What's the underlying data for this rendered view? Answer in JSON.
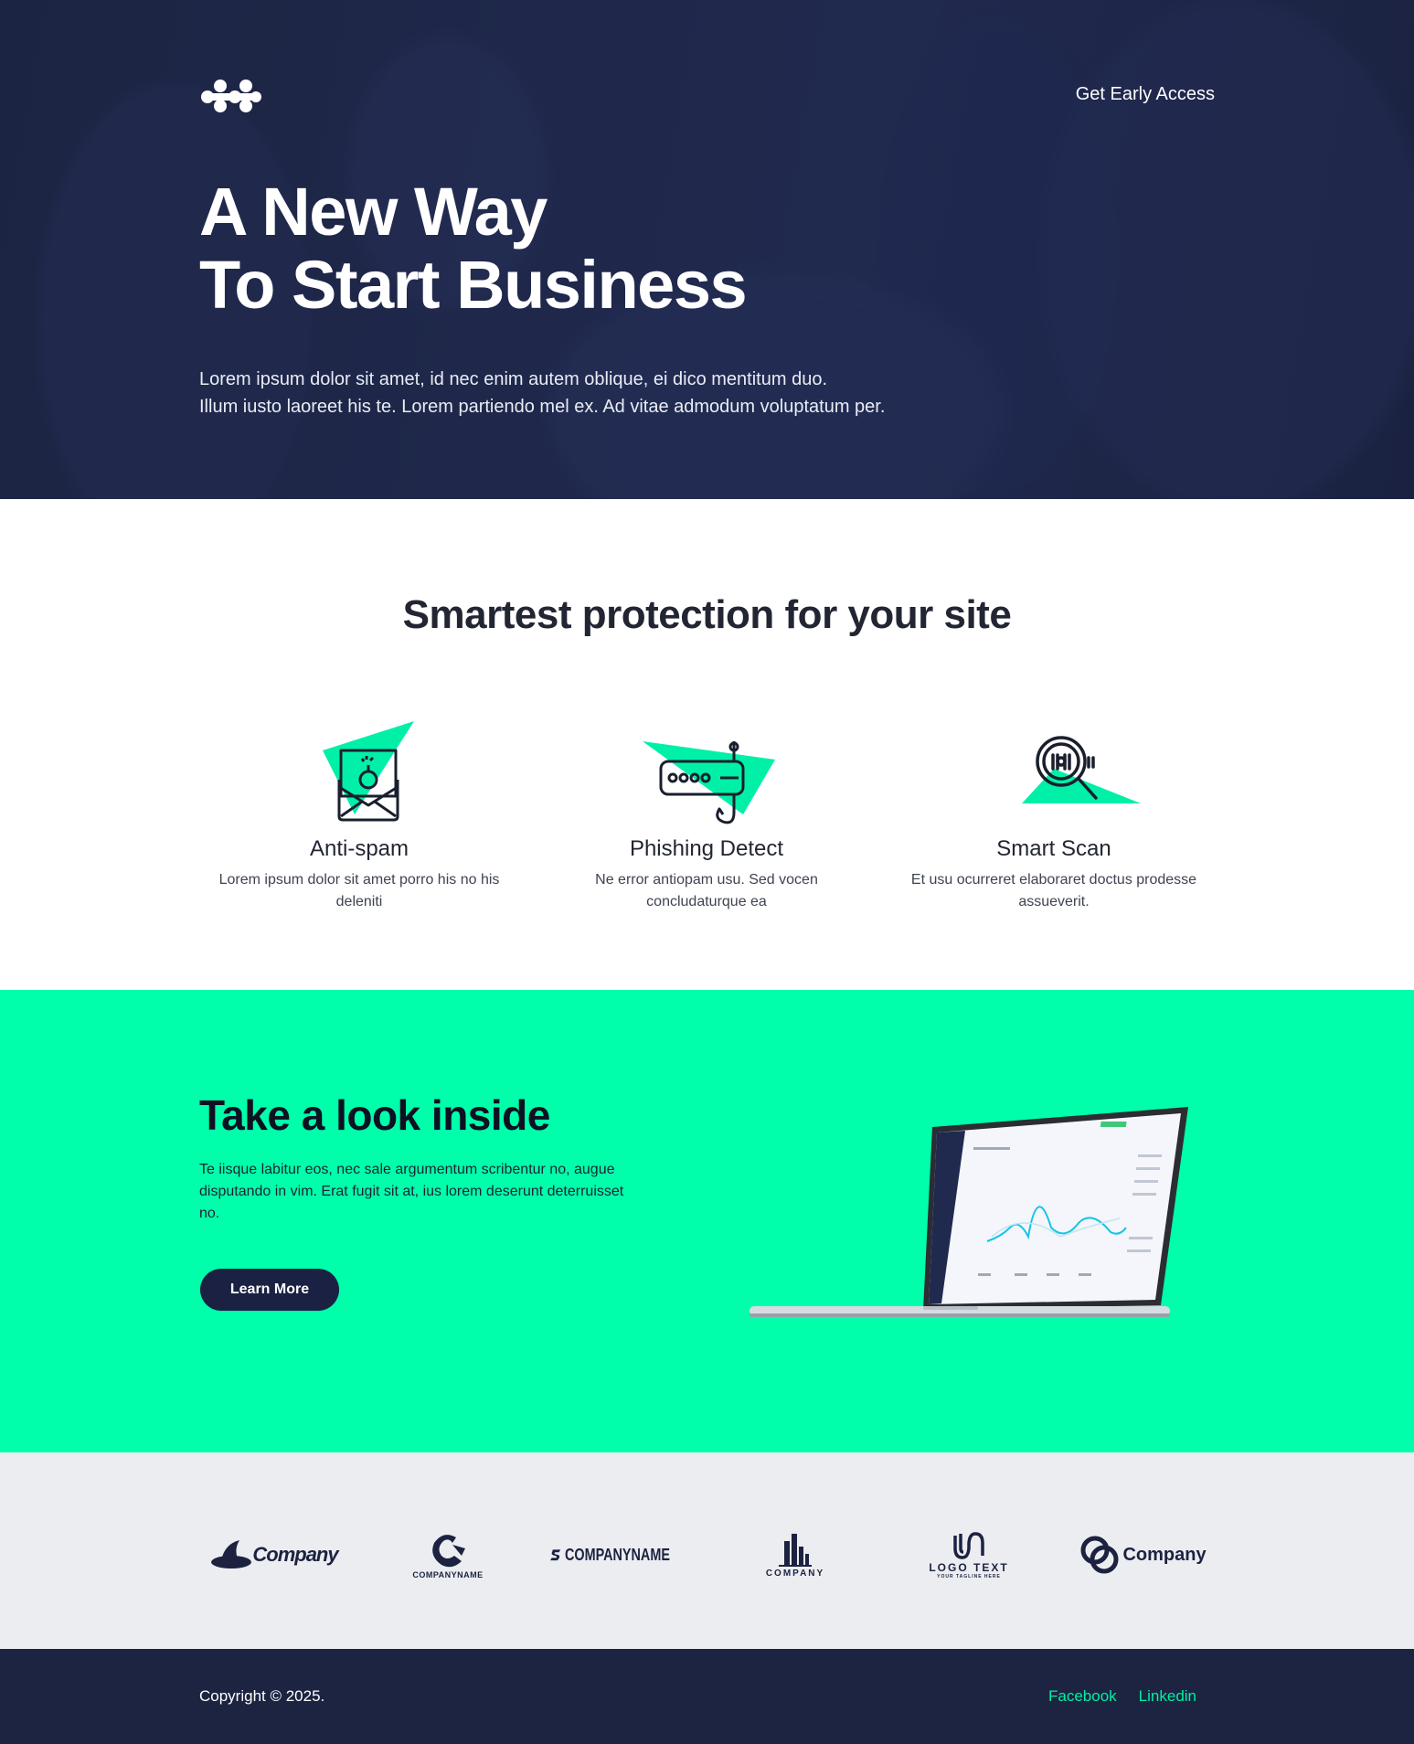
{
  "nav": {
    "cta_label": "Get Early Access"
  },
  "hero": {
    "title_line1": "A New Way",
    "title_line2": "To Start Business",
    "subtitle_line1": "Lorem ipsum dolor sit amet, id nec enim autem oblique, ei dico mentitum duo.",
    "subtitle_line2": "Illum iusto laoreet his te. Lorem partiendo mel ex. Ad vitae admodum voluptatum per."
  },
  "features": {
    "title": "Smartest protection for your site",
    "items": [
      {
        "icon": "envelope-bomb-icon",
        "title": "Anti-spam",
        "text": "Lorem ipsum dolor sit amet porro his no his deleniti"
      },
      {
        "icon": "router-phishing-icon",
        "title": "Phishing Detect",
        "text": "Ne error antiopam usu. Sed vocen concludaturque ea"
      },
      {
        "icon": "magnifier-scan-icon",
        "title": "Smart Scan",
        "text": "Et usu ocurreret elaboraret doctus prodesse assueverit."
      }
    ]
  },
  "inside": {
    "title": "Take a look inside",
    "text": "Te iisque labitur eos, nec sale argumentum scribentur no, augue disputando in vim. Erat fugit sit at, ius lorem deserunt deterruisset no.",
    "button_label": "Learn More"
  },
  "clients": {
    "logos": [
      {
        "name": "Company"
      },
      {
        "name": "COMPANYNAME"
      },
      {
        "name": "COMPANYNAME"
      },
      {
        "name": "COMPANY"
      },
      {
        "name": "LOGO TEXT",
        "tagline": "YOUR TAGLINE HERE"
      },
      {
        "name": "Company"
      }
    ]
  },
  "footer": {
    "copyright": "Copyright © 2025.",
    "links": [
      "Facebook",
      "Linkedin"
    ]
  },
  "colors": {
    "navy": "#1c2442",
    "accent": "#00ffaa",
    "text": "#222633"
  }
}
